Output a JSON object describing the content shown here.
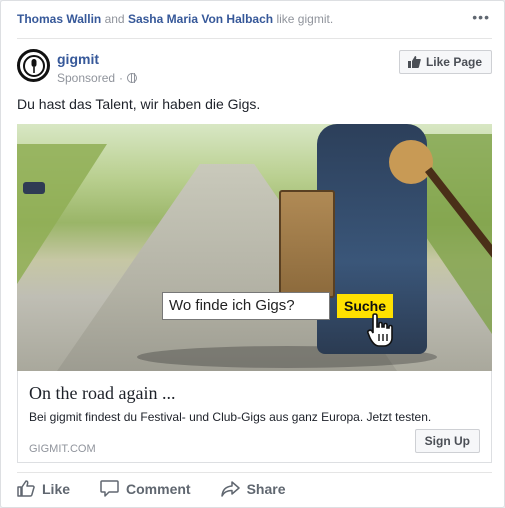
{
  "context": {
    "friend1": "Thomas Wallin",
    "joiner": "and",
    "friend2": "Sasha Maria Von Halbach",
    "suffix": "like gigmit.",
    "more_icon": "ellipsis-icon"
  },
  "header": {
    "page_name": "gigmit",
    "sponsored": "Sponsored",
    "separator": "·",
    "like_page_label": "Like Page"
  },
  "post": {
    "text": "Du hast das Talent, wir haben die Gigs."
  },
  "creative": {
    "search_text": "Wo finde ich Gigs?",
    "search_button": "Suche",
    "accent_color": "#ffe100"
  },
  "link": {
    "headline": "On the road again ...",
    "description": "Bei gigmit findest du Festival- und Club-Gigs aus ganz Europa. Jetzt testen.",
    "domain": "GIGMIT.COM",
    "cta_label": "Sign Up"
  },
  "actions": {
    "like": "Like",
    "comment": "Comment",
    "share": "Share"
  },
  "colors": {
    "link": "#365899",
    "meta": "#90949c",
    "action": "#606770"
  }
}
